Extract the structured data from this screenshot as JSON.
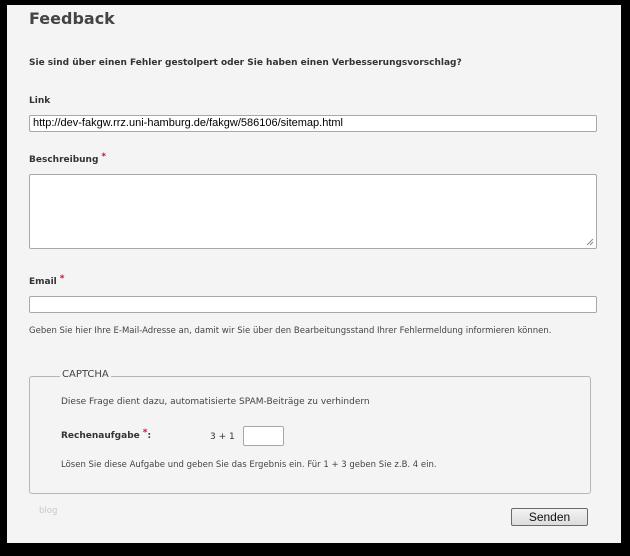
{
  "form": {
    "title": "Feedback",
    "intro": "Sie sind über einen Fehler gestolpert oder Sie haben einen Verbesserungsvorschlag?",
    "link": {
      "label": "Link",
      "value": "http://dev-fakgw.rrz.uni-hamburg.de/fakgw/586106/sitemap.html"
    },
    "description": {
      "label": "Beschreibung",
      "required_mark": "*",
      "value": ""
    },
    "email": {
      "label": "Email",
      "required_mark": "*",
      "value": "",
      "help": "Geben Sie hier Ihre E-Mail-Adresse an, damit wir Sie über den Bearbeitungsstand Ihrer Fehlermeldung informieren können."
    },
    "captcha": {
      "legend": "CAPTCHA",
      "description": "Diese Frage dient dazu, automatisierte SPAM-Beiträge zu verhindern",
      "label": "Rechenaufgabe",
      "required_mark": "*",
      "label_suffix": ":",
      "problem": "3 + 1",
      "answer": "",
      "help": "Lösen Sie diese Aufgabe und geben Sie das Ergebnis ein. Für 1 + 3 geben Sie z.B. 4 ein."
    },
    "footer_text": "blog",
    "send_label": "Senden"
  },
  "colors": {
    "required": "#c8102e",
    "background": "#f4f4f4",
    "frame": "#000000"
  }
}
